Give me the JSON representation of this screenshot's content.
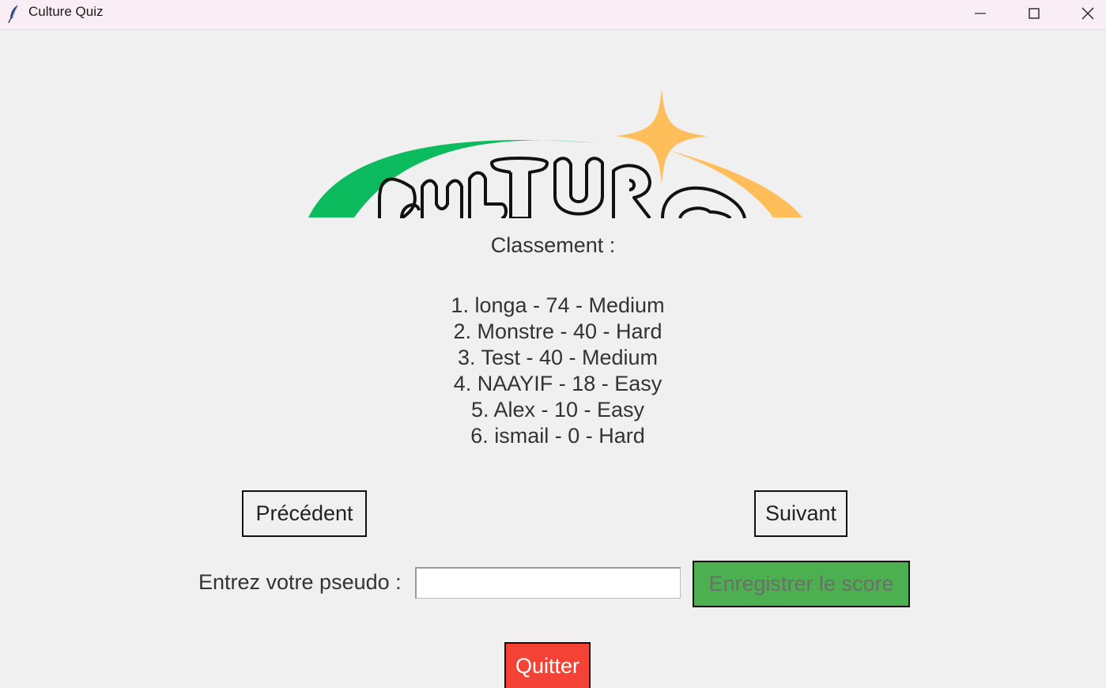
{
  "window": {
    "title": "Culture Quiz",
    "icons": {
      "app": "feather-icon",
      "minimize": "minimize-icon",
      "maximize": "maximize-icon",
      "close": "close-icon"
    }
  },
  "logo": {
    "text": "CULTURE",
    "colors": {
      "arc_left": "#0dbb5f",
      "arc_right": "#ffbe5a",
      "star": "#ffbe5a",
      "outline": "#111111"
    }
  },
  "leaderboard": {
    "heading": "Classement :",
    "entries": [
      "1. longa - 74 - Medium",
      "2. Monstre - 40 - Hard",
      "3. Test - 40 - Medium",
      "4. NAAYIF - 18 - Easy",
      "5. Alex - 10 - Easy",
      "6. ismail - 0 - Hard"
    ]
  },
  "navigation": {
    "previous_label": "Précédent",
    "next_label": "Suivant"
  },
  "form": {
    "pseudo_label": "Entrez votre pseudo :",
    "pseudo_value": "",
    "save_label": "Enregistrer le score"
  },
  "quit_label": "Quitter",
  "colors": {
    "background": "#f0f0f0",
    "save_button": "#4caf50",
    "quit_button": "#f44336"
  }
}
